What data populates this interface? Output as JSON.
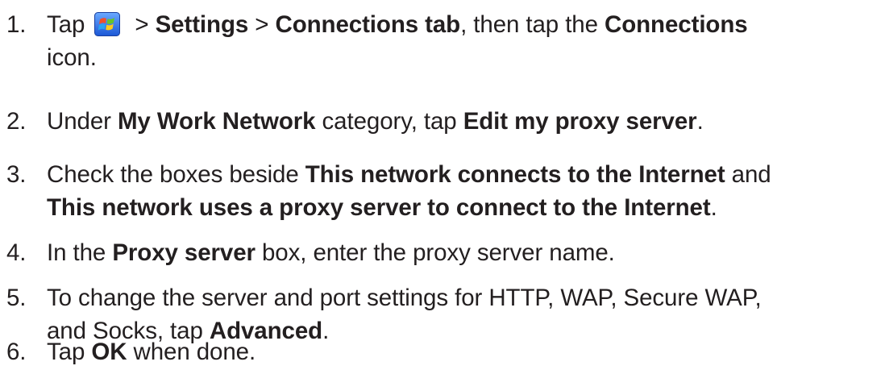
{
  "steps": [
    {
      "number": "1.",
      "parts": {
        "t1": "Tap",
        "icon": "windows-start-icon",
        "t2": " > ",
        "b1": "Settings",
        "t3": " > ",
        "b2": "Connections tab",
        "t4": ", then tap the ",
        "b3": "Connections",
        "t5": "icon."
      }
    },
    {
      "number": "2.",
      "parts": {
        "t1": "Under ",
        "b1": "My Work Network",
        "t2": " category, tap ",
        "b2": "Edit my proxy server",
        "t3": "."
      }
    },
    {
      "number": "3.",
      "parts": {
        "t1": "Check the boxes beside ",
        "b1": "This network connects to the Internet",
        "t2": " and",
        "b2": "This network uses a proxy server to connect to the Internet",
        "t3": "."
      }
    },
    {
      "number": "4.",
      "parts": {
        "t1": "In the ",
        "b1": "Proxy server",
        "t2": " box, enter the proxy server name."
      }
    },
    {
      "number": "5.",
      "parts": {
        "t1": "To change the server and port settings for HTTP, WAP, Secure WAP,",
        "t2": "and Socks, tap ",
        "b1": "Advanced",
        "t3": "."
      }
    },
    {
      "number": "6.",
      "parts": {
        "t1": "Tap ",
        "b1": "OK",
        "t2": " when done."
      }
    }
  ]
}
